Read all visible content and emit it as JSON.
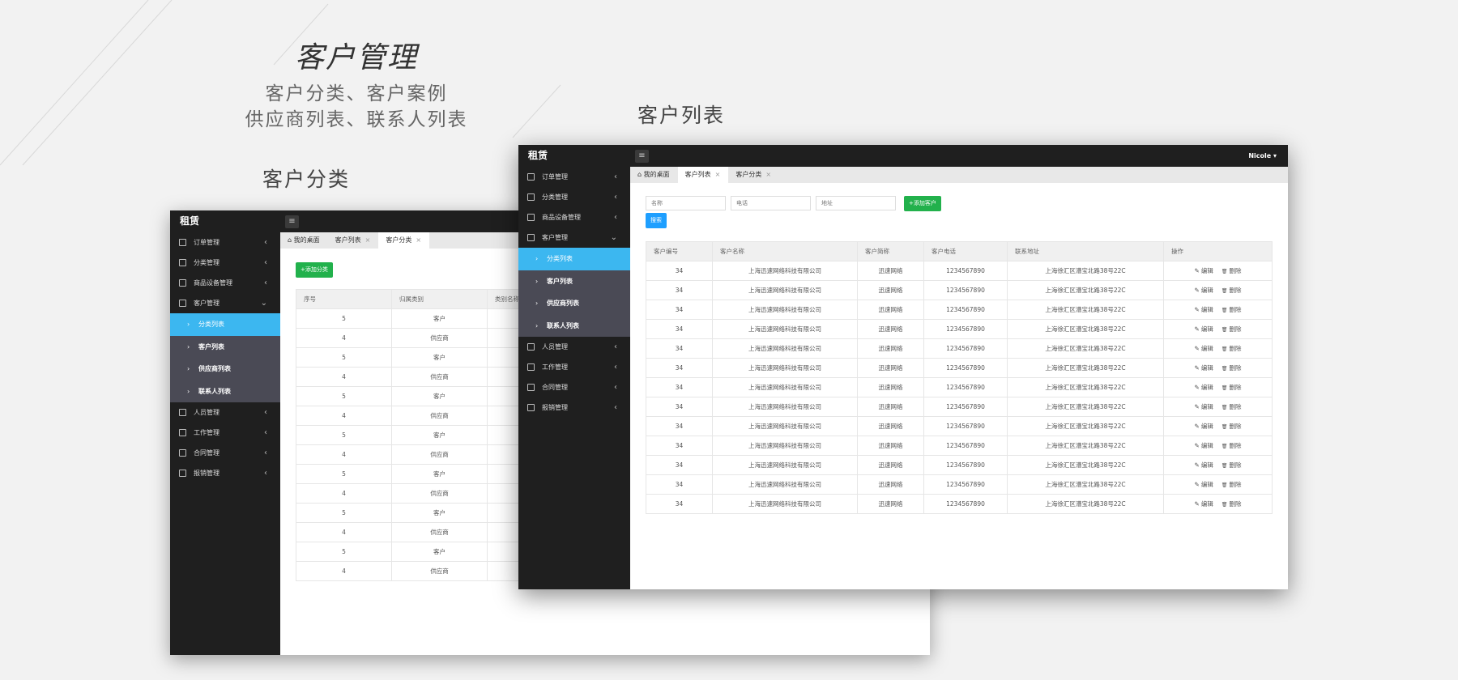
{
  "hero": {
    "title": "客户管理",
    "subtitle_line1": "客户分类、客户案例",
    "subtitle_line2": "供应商列表、联系人列表",
    "caption_left": "客户分类",
    "caption_right": "客户列表"
  },
  "app": {
    "brand": "租赁",
    "user": "Nicole",
    "menu": [
      {
        "label": "订单管理",
        "icon": "order-icon"
      },
      {
        "label": "分类管理",
        "icon": "category-icon"
      },
      {
        "label": "商品设备管理",
        "icon": "product-icon"
      },
      {
        "label": "客户管理",
        "icon": "customer-icon"
      }
    ],
    "submenu": [
      "分类列表",
      "客户列表",
      "供应商列表",
      "联系人列表"
    ],
    "menu_after": [
      {
        "label": "人员管理",
        "icon": "staff-icon"
      },
      {
        "label": "工作管理",
        "icon": "work-icon"
      },
      {
        "label": "合同管理",
        "icon": "contract-icon"
      },
      {
        "label": "报销管理",
        "icon": "expense-icon"
      }
    ],
    "colors": {
      "sidebar": "#1f1f1f",
      "submenu": "#4a4a55",
      "active": "#3cb7f0",
      "add_button": "#22b14c",
      "search_button": "#1e9fff"
    }
  },
  "category_window": {
    "tabs": [
      "我的桌面",
      "客户列表",
      "客户分类"
    ],
    "add_button": "+添加分类",
    "columns": [
      "序号",
      "归属类别",
      "类别名称"
    ],
    "rows": [
      [
        "5",
        "客户"
      ],
      [
        "4",
        "供应商"
      ],
      [
        "5",
        "客户"
      ],
      [
        "4",
        "供应商"
      ],
      [
        "5",
        "客户"
      ],
      [
        "4",
        "供应商"
      ],
      [
        "5",
        "客户"
      ],
      [
        "4",
        "供应商"
      ],
      [
        "5",
        "客户"
      ],
      [
        "4",
        "供应商"
      ],
      [
        "5",
        "客户"
      ],
      [
        "4",
        "供应商"
      ],
      [
        "5",
        "客户"
      ],
      [
        "4",
        "供应商"
      ]
    ]
  },
  "customer_window": {
    "tabs": [
      "我的桌面",
      "客户列表",
      "客户分类"
    ],
    "placeholders": {
      "name": "名称",
      "phone": "电话",
      "address": "地址"
    },
    "add_button": "+添加客户",
    "search_button": "搜索",
    "columns": [
      "客户编号",
      "客户名称",
      "客户简称",
      "客户电话",
      "联系地址",
      "操作"
    ],
    "row": {
      "id": "34",
      "name": "上海迅速网络科技有限公司",
      "short": "迅速网络",
      "phone": "1234567890",
      "address": "上海徐汇区漕宝北路38号22C"
    },
    "row_count": 13,
    "edit_label": "编辑",
    "delete_label": "删除"
  }
}
